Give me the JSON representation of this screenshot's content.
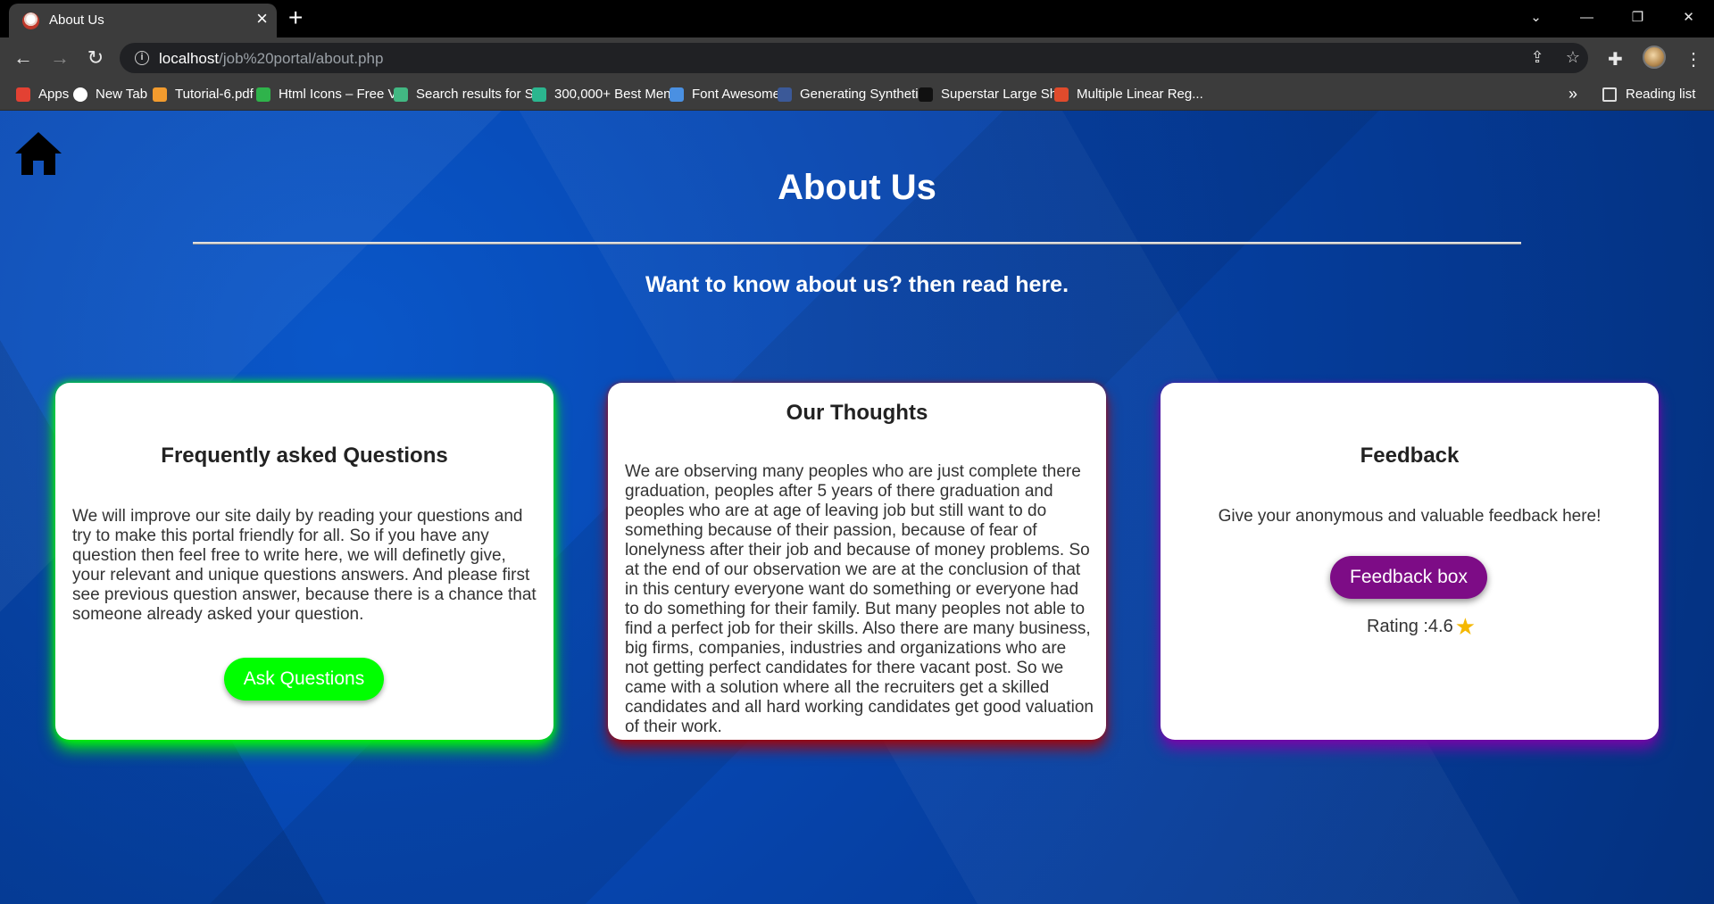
{
  "browser": {
    "tab_title": "About Us",
    "url_host": "localhost",
    "url_path": "/job%20portal/about.php",
    "bookmarks": [
      {
        "label": "Apps",
        "icon": "apps-grid-icon",
        "color": "#e34133"
      },
      {
        "label": "New Tab",
        "icon": "globe-icon",
        "color": "#ffffff"
      },
      {
        "label": "Tutorial-6.pdf",
        "icon": "pdf-icon",
        "color": "#f29b2e"
      },
      {
        "label": "Html Icons – Free V...",
        "icon": "html-icons-icon",
        "color": "#2fb34b"
      },
      {
        "label": "Search results for S...",
        "icon": "vue-icon",
        "color": "#42b883"
      },
      {
        "label": "300,000+ Best Men...",
        "icon": "stock-icon",
        "color": "#2bb68f"
      },
      {
        "label": "Font Awesome",
        "icon": "flag-icon",
        "color": "#4a90e2"
      },
      {
        "label": "Generating Syntheti...",
        "icon": "tds-icon",
        "color": "#3b5998"
      },
      {
        "label": "Superstar Large Sh...",
        "icon": "superstar-icon",
        "color": "#111111"
      },
      {
        "label": "Multiple Linear Reg...",
        "icon": "sa-icon",
        "color": "#e04b2c"
      }
    ],
    "reading_list": "Reading list",
    "more": "»"
  },
  "page": {
    "title": "About Us",
    "subtitle": "Want to know about us? then read here."
  },
  "faq": {
    "title": "Frequently asked Questions",
    "text": "We will improve our site daily by reading your questions and try to make this portal friendly for all. So if you have any question then feel free to write here, we will definetly give, your relevant and unique questions answers. And please first see previous question answer, because there is a chance that someone already asked your question.",
    "button": "Ask Questions",
    "accent": "#00ff00"
  },
  "thoughts": {
    "title": "Our Thoughts",
    "text": "We are observing many peoples who are just complete there graduation, peoples after 5 years of there graduation and peoples who are at age of leaving job but still want to do something because of their passion, because of fear of lonelyness after their job and because of money problems. So at the end of our observation we are at the conclusion of that in this century everyone want do something or everyone had to do something for their family. But many peoples not able to find a perfect job for their skills. Also there are many business, big firms, companies, industries and organizations who are not getting perfect candidates for there vacant post. So we came with a solution where all the recruiters get a skilled candidates and all hard working candidates get good valuation of their work.",
    "accent": "#aa0000"
  },
  "feedback": {
    "title": "Feedback",
    "text": "Give your anonymous and valuable feedback here!",
    "button": "Feedback box",
    "rating_label": "Rating :4.6",
    "accent": "#7d0c86"
  }
}
